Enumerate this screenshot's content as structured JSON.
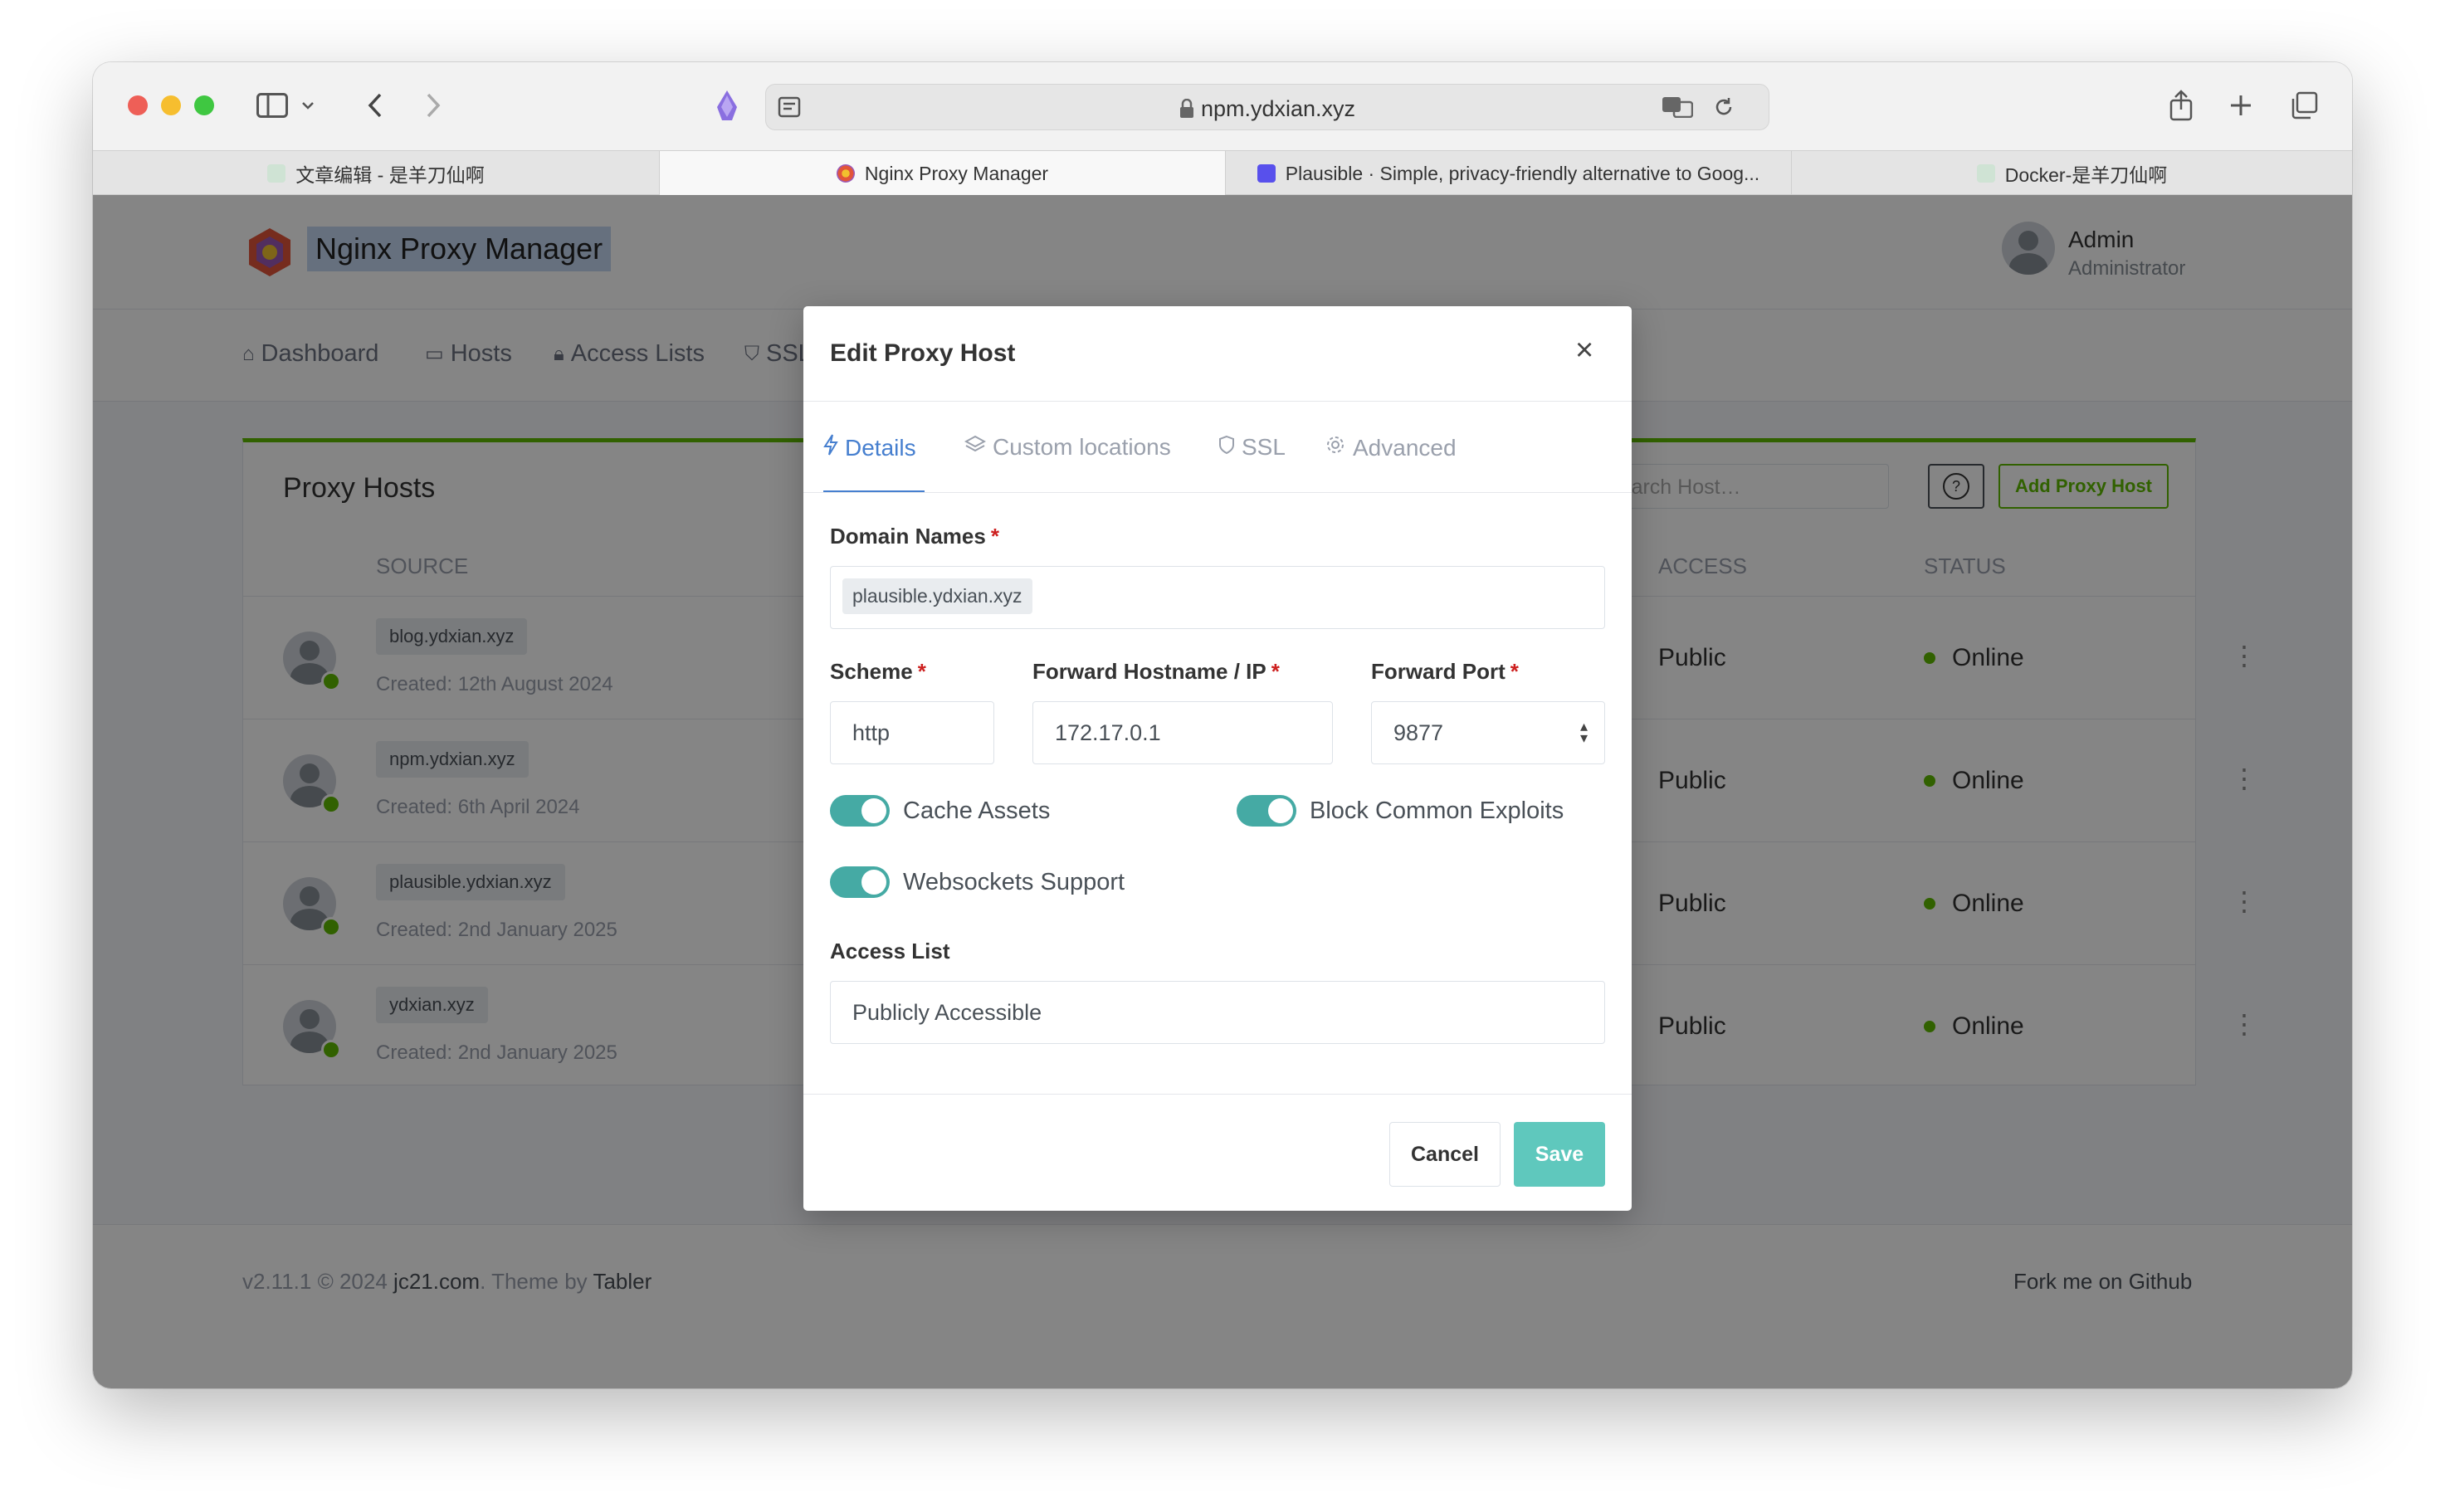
{
  "browser": {
    "url": "npm.ydxian.xyz",
    "tabs": [
      {
        "title": "文章编辑 - 是羊刀仙啊"
      },
      {
        "title": "Nginx Proxy Manager"
      },
      {
        "title": "Plausible · Simple, privacy-friendly alternative to Goog..."
      },
      {
        "title": "Docker-是羊刀仙啊"
      }
    ],
    "tab_close": "×"
  },
  "app": {
    "brand": "Nginx Proxy Manager",
    "user": {
      "name": "Admin",
      "role": "Administrator"
    },
    "nav": [
      {
        "label": "Dashboard"
      },
      {
        "label": "Hosts"
      },
      {
        "label": "Access Lists"
      },
      {
        "label": "SSL"
      }
    ]
  },
  "proxy_hosts": {
    "title": "Proxy Hosts",
    "search_placeholder": "Search Host…",
    "help_label": "?",
    "add_label": "Add Proxy Host",
    "columns": {
      "source": "SOURCE",
      "access": "ACCESS",
      "status": "STATUS"
    },
    "rows": [
      {
        "domain": "blog.ydxian.xyz",
        "created": "Created: 12th August 2024",
        "access": "Public",
        "status": "Online"
      },
      {
        "domain": "npm.ydxian.xyz",
        "created": "Created: 6th April 2024",
        "access": "Public",
        "status": "Online"
      },
      {
        "domain": "plausible.ydxian.xyz",
        "created": "Created: 2nd January 2025",
        "access": "Public",
        "status": "Online"
      },
      {
        "domain": "ydxian.xyz",
        "created": "Created: 2nd January 2025",
        "access": "Public",
        "status": "Online"
      }
    ]
  },
  "footer": {
    "version": "v2.11.1 © 2024",
    "jc21": "jc21.com",
    "theme_by": ". Theme by",
    "tabler": "Tabler",
    "fork": "Fork me on Github"
  },
  "modal": {
    "title": "Edit Proxy Host",
    "close": "×",
    "tabs": [
      {
        "label": "Details",
        "icon": "bolt-icon",
        "active": true
      },
      {
        "label": "Custom locations",
        "icon": "layers-icon",
        "active": false
      },
      {
        "label": "SSL",
        "icon": "shield-icon",
        "active": false
      },
      {
        "label": "Advanced",
        "icon": "gear-icon",
        "active": false
      }
    ],
    "domain_names_label": "Domain Names",
    "domain_chip": "plausible.ydxian.xyz",
    "scheme_label": "Scheme",
    "scheme_value": "http",
    "hostname_label": "Forward Hostname / IP",
    "hostname_value": "172.17.0.1",
    "port_label": "Forward Port",
    "port_value": "9877",
    "required_mark": "*",
    "toggles": {
      "cache_assets": {
        "label": "Cache Assets",
        "on": true
      },
      "block_exploits": {
        "label": "Block Common Exploits",
        "on": true
      },
      "websockets": {
        "label": "Websockets Support",
        "on": true
      }
    },
    "access_list_label": "Access List",
    "access_list_value": "Publicly Accessible",
    "cancel": "Cancel",
    "save": "Save"
  },
  "colors": {
    "accent_green": "#5eba00",
    "tab_blue": "#467fcf",
    "toggle_teal": "#45aaa4",
    "save_teal": "#5fc8bd"
  }
}
